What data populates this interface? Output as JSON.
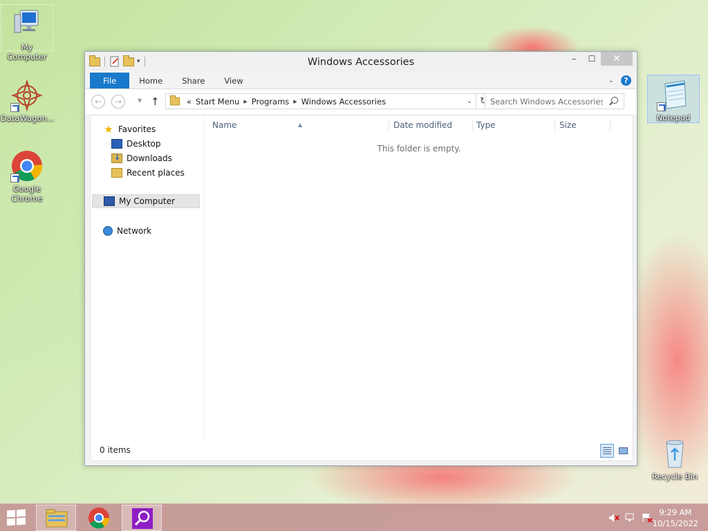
{
  "desktop": {
    "icons": [
      {
        "label": "My Computer"
      },
      {
        "label": "DataWagon..."
      },
      {
        "label": "Google Chrome"
      },
      {
        "label": "Notepad"
      },
      {
        "label": "Recycle Bin"
      }
    ]
  },
  "window": {
    "title": "Windows Accessories",
    "controls": {
      "minimize": "–",
      "maximize": "☐",
      "close": "✕"
    },
    "ribbon_tabs": [
      "File",
      "Home",
      "Share",
      "View"
    ],
    "address": {
      "overflow": "«",
      "crumbs": [
        "Start Menu",
        "Programs",
        "Windows Accessories"
      ]
    },
    "search": {
      "placeholder": "Search Windows Accessories"
    },
    "nav_pane": {
      "favorites": "Favorites",
      "favorite_items": [
        "Desktop",
        "Downloads",
        "Recent places"
      ],
      "computer": "My Computer",
      "network": "Network"
    },
    "columns": [
      "Name",
      "Date modified",
      "Type",
      "Size"
    ],
    "empty_message": "This folder is empty.",
    "status": "0 items"
  },
  "taskbar": {
    "time": "9:29 AM",
    "date": "10/15/2022"
  },
  "colors": {
    "accent": "#1979ca",
    "taskbar": "#c49696"
  }
}
